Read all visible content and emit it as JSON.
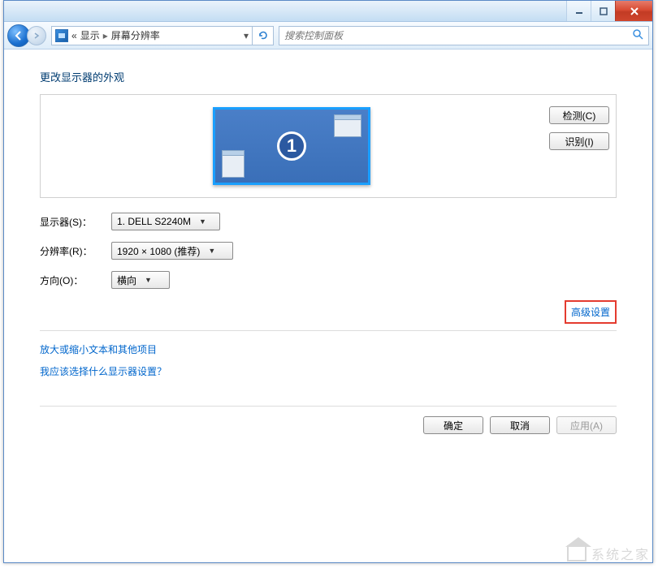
{
  "titlebar": {},
  "nav": {
    "breadcrumb_prefix": "«",
    "breadcrumb_item1": "显示",
    "breadcrumb_sep": "▸",
    "breadcrumb_item2": "屏幕分辨率",
    "search_placeholder": "搜索控制面板"
  },
  "main": {
    "heading": "更改显示器的外观",
    "detect_btn": "检测(C)",
    "identify_btn": "识别(I)",
    "monitor_number": "1",
    "labels": {
      "display": "显示器(S)：",
      "resolution": "分辨率(R)：",
      "orientation": "方向(O)："
    },
    "values": {
      "display": "1. DELL S2240M",
      "resolution": "1920 × 1080 (推荐)",
      "orientation": "横向"
    },
    "advanced_link": "高级设置",
    "link1": "放大或缩小文本和其他项目",
    "link2": "我应该选择什么显示器设置？",
    "ok_btn": "确定",
    "cancel_btn": "取消",
    "apply_btn": "应用(A)"
  },
  "watermark": "系统之家"
}
